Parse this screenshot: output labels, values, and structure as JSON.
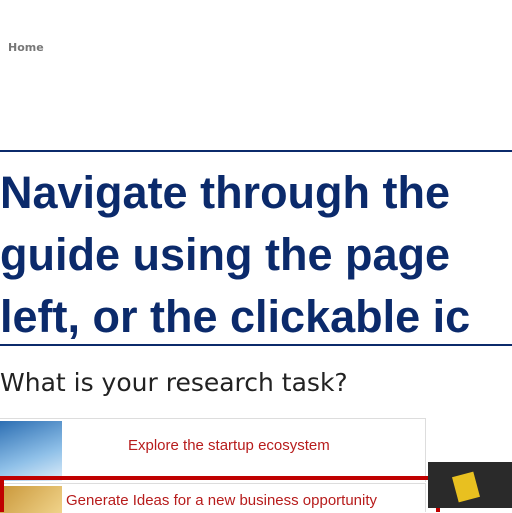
{
  "nav": {
    "home": "Home"
  },
  "banner": {
    "lines": [
      "Navigate through the",
      "guide using the page",
      "left, or the clickable ic"
    ]
  },
  "question": "What is your research task?",
  "tasks": [
    {
      "label": "Explore the startup ecosystem",
      "icon": "explorer-photo"
    },
    {
      "label": "Generate Ideas for a new business opportunity",
      "icon": "old-paper-photo"
    }
  ],
  "colors": {
    "banner": "#0b2a6b",
    "link": "#b71c1c",
    "highlight": "#c00000"
  }
}
